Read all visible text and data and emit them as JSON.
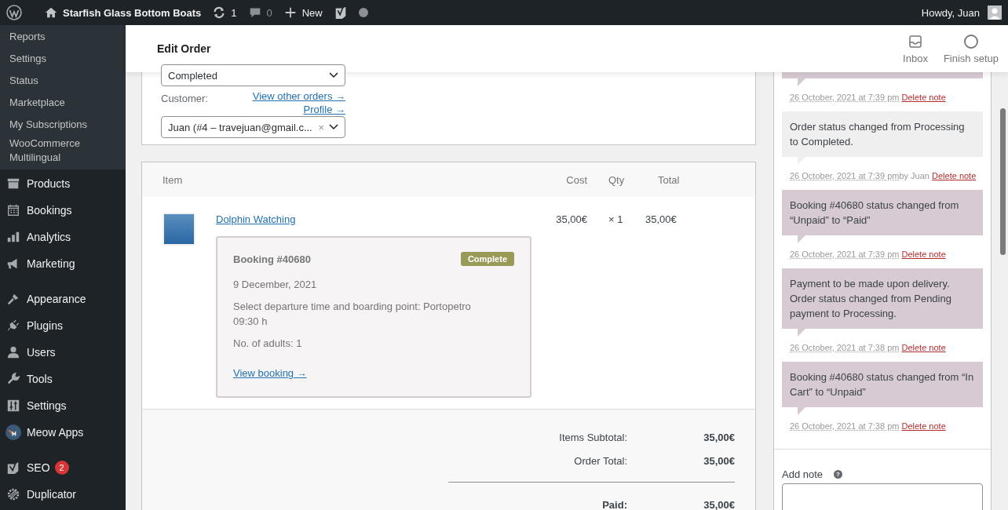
{
  "admin_bar": {
    "site_name": "Starfish Glass Bottom Boats",
    "updates": "1",
    "comments": "0",
    "new_label": "New",
    "greeting": "Howdy, Juan"
  },
  "sidebar": {
    "submenu": [
      {
        "label": "Reports"
      },
      {
        "label": "Settings"
      },
      {
        "label": "Status"
      },
      {
        "label": "Marketplace"
      },
      {
        "label": "My Subscriptions"
      },
      {
        "label": "WooCommerce Multilingual"
      }
    ],
    "groups": [
      [
        {
          "label": "Products"
        },
        {
          "label": "Bookings"
        },
        {
          "label": "Analytics"
        },
        {
          "label": "Marketing"
        }
      ],
      [
        {
          "label": "Appearance"
        },
        {
          "label": "Plugins"
        },
        {
          "label": "Users"
        },
        {
          "label": "Tools"
        },
        {
          "label": "Settings"
        },
        {
          "label": "Meow Apps"
        }
      ],
      [
        {
          "label": "SEO",
          "badge": "2"
        },
        {
          "label": "Duplicator"
        }
      ]
    ]
  },
  "header": {
    "title": "Edit Order",
    "actions": [
      {
        "label": "Inbox"
      },
      {
        "label": "Finish setup"
      }
    ]
  },
  "order": {
    "status": "Completed",
    "customer_label": "Customer:",
    "links": [
      "View other orders →",
      "Profile →"
    ],
    "customer": "Juan (#4 – travejuan@gmail.c...",
    "clear": "×"
  },
  "items": {
    "columns": [
      "Item",
      "Cost",
      "Qty",
      "Total"
    ],
    "rows": [
      {
        "name": "Dolphin Watching",
        "cost": "35,00€",
        "qty": "× 1",
        "total": "35,00€",
        "booking": {
          "title": "Booking #40680",
          "status": "Complete",
          "lines": [
            "9 December, 2021",
            "Select departure time and boarding point: Portopetro 09:30 h",
            "No. of adults: 1"
          ],
          "link": "View booking →"
        }
      }
    ],
    "totals": [
      {
        "label": "Items Subtotal:",
        "value": "35,00€",
        "strong": false
      },
      {
        "label": "Order Total:",
        "value": "35,00€",
        "strong": false
      },
      {
        "label": "Paid:",
        "value": "35,00€",
        "strong": true
      }
    ]
  },
  "notes": [
    {
      "kind": "system",
      "date": "26 October, 2021 at 7:39 pm",
      "delete": "Delete note"
    },
    {
      "kind": "private",
      "text": "Order status changed from Processing to Completed.",
      "date": "26 October, 2021 at 7:39 pm",
      "author": "by Juan",
      "delete": "Delete note"
    },
    {
      "kind": "system",
      "text": "Booking #40680 status changed from “Unpaid” to “Paid”",
      "date": "26 October, 2021 at 7:39 pm",
      "delete": "Delete note"
    },
    {
      "kind": "system",
      "text": "Payment to be made upon delivery. Order status changed from Pending payment to Processing.",
      "date": "26 October, 2021 at 7:38 pm",
      "delete": "Delete note"
    },
    {
      "kind": "system",
      "text": "Booking #40680 status changed from “In Cart” to “Unpaid”",
      "date": "26 October, 2021 at 7:38 pm",
      "delete": "Delete note"
    }
  ],
  "add_note": {
    "label": "Add note",
    "help": "?"
  }
}
